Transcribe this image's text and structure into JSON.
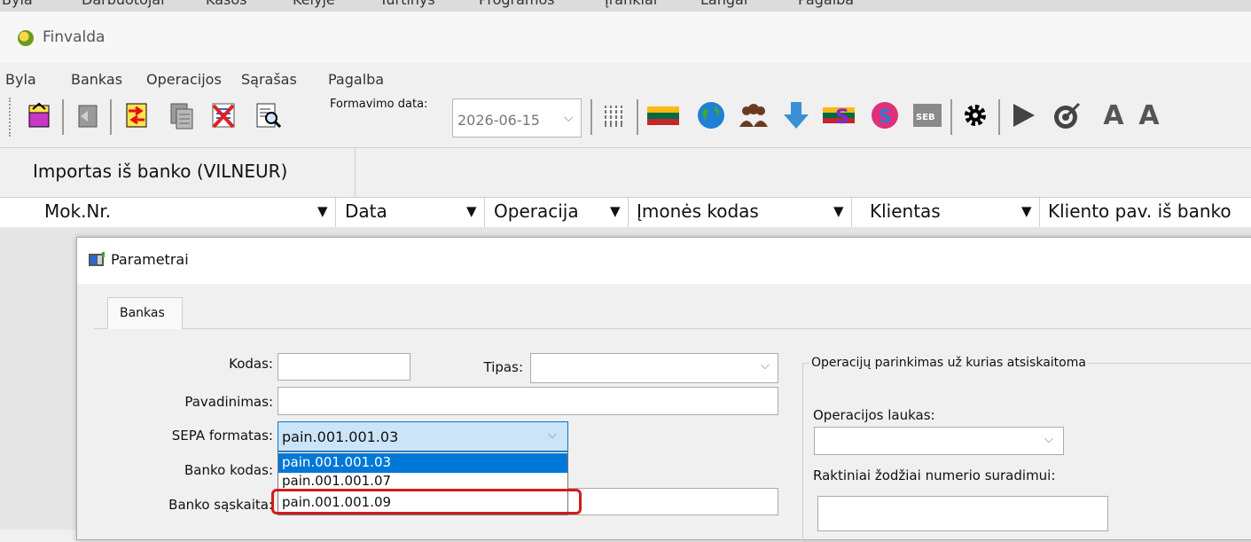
{
  "background_strip": {
    "items": [
      "Byla",
      "Darbuotojai",
      "Kasos",
      "Kelyje",
      "Turtinys",
      "Programos",
      "Įrankiai",
      "Langai",
      "Pagalba"
    ]
  },
  "app": {
    "title": "Finvalda"
  },
  "menu": {
    "items": [
      "Byla",
      "Bankas",
      "Operacijos",
      "Sąrašas",
      "Pagalba"
    ]
  },
  "toolbar": {
    "date_label": "Formavimo data:",
    "date_value": "2026-06-15",
    "icons": [
      "import-box-icon",
      "back-icon",
      "transfer-icon",
      "copy-icon",
      "delete-list-icon",
      "search-doc-icon",
      "columns-icon",
      "lithuania-flag-icon",
      "globe-icon",
      "users-icon",
      "download-arrow-icon",
      "flag-s-icon",
      "s-badge-icon",
      "seb-icon",
      "gear-icon",
      "play-icon",
      "target-icon",
      "font-a-icon",
      "font-settings-icon"
    ]
  },
  "tab": {
    "label": "Importas iš banko (VILNEUR)"
  },
  "grid": {
    "columns": [
      "Mok.Nr.",
      "Data",
      "Operacija",
      "Įmonės kodas",
      "Klientas",
      "Kliento pav. iš banko"
    ]
  },
  "dialog": {
    "title": "Parametrai",
    "tab_label": "Bankas",
    "fields": {
      "kodas_label": "Kodas:",
      "kodas_value": "",
      "tipas_label": "Tipas:",
      "tipas_value": "",
      "pavadinimas_label": "Pavadinimas:",
      "pavadinimas_value": "",
      "sepa_label": "SEPA formatas:",
      "sepa_value": "pain.001.001.03",
      "banko_kodas_label": "Banko kodas:",
      "banko_saskaita_label": "Banko sąskaita:"
    },
    "sepa_options": [
      "pain.001.001.03",
      "pain.001.001.07",
      "pain.001.001.09"
    ],
    "selected_option": "pain.001.001.03",
    "highlighted_option": "pain.001.001.09",
    "group": {
      "title": "Operacijų parinkimas už kurias atsiskaitoma",
      "op_field_label": "Operacijos laukas:",
      "op_field_value": "",
      "keywords_label": "Raktiniai žodžiai numerio suradimui:"
    }
  },
  "colors": {
    "selection": "#0078d7",
    "highlight_ring": "#d11c1c",
    "combo_focus": "#cce4f7"
  }
}
